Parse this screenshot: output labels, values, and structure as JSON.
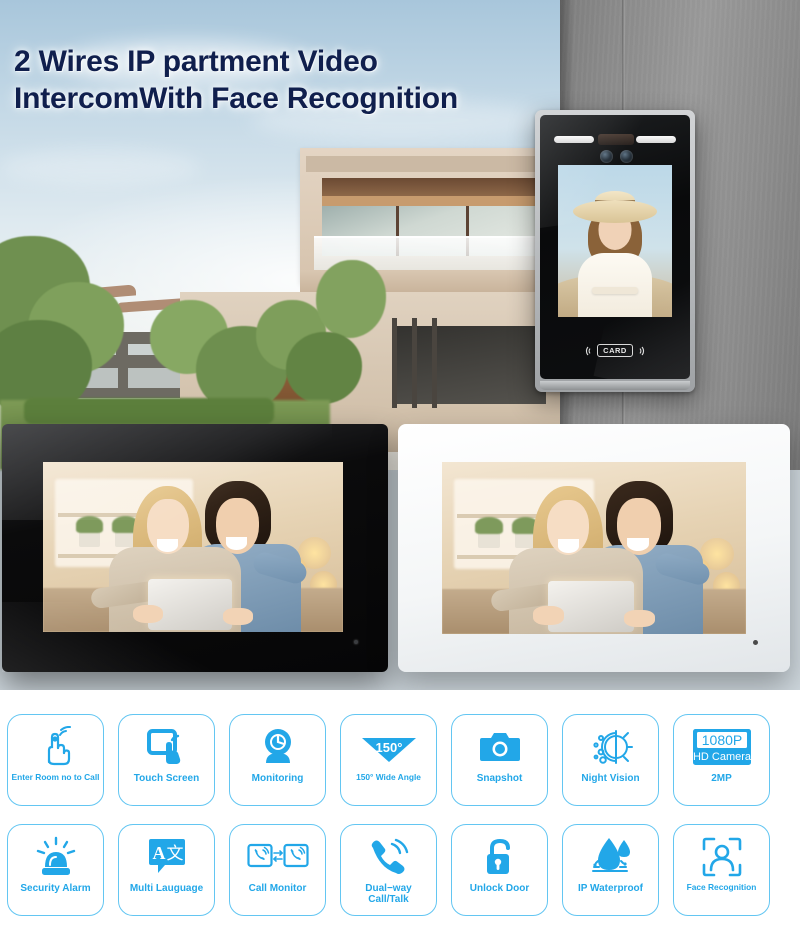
{
  "headline": {
    "line1": "2 Wires IP partment Video",
    "line2": "IntercomWith Face Recognition",
    "color": "#101f4d"
  },
  "colors": {
    "accent": "#22a7e8",
    "tile_border": "#63c6f2",
    "headline": "#101f4d",
    "background": "#ffffff"
  },
  "door_station": {
    "name": "face-recognition-door-station",
    "card_label": "CARD",
    "body_color": "#0b0c0d",
    "trim_color": "#b9bcbf"
  },
  "monitors": [
    {
      "name": "indoor-monitor-black",
      "finish": "Black"
    },
    {
      "name": "indoor-monitor-white",
      "finish": "White"
    }
  ],
  "features": {
    "row1": [
      {
        "label": "Enter Room no to Call",
        "icon": "hand-tap-call-icon",
        "small": true
      },
      {
        "label": "Touch Screen",
        "icon": "touch-screen-icon"
      },
      {
        "label": "Monitoring",
        "icon": "camera-monitor-icon"
      },
      {
        "label": "150° Wide Angle",
        "icon": "wide-angle-icon",
        "badge": "150°",
        "small": true
      },
      {
        "label": "Snapshot",
        "icon": "camera-snapshot-icon"
      },
      {
        "label": "Night Vision",
        "icon": "night-vision-icon"
      },
      {
        "label": "2MP",
        "icon": "hd-camera-badge-icon",
        "badge_top": "1080P",
        "badge_bottom": "HD Camera"
      }
    ],
    "row2": [
      {
        "label": "Security Alarm",
        "icon": "alarm-siren-icon"
      },
      {
        "label": "Multi Lauguage",
        "icon": "multi-language-icon",
        "badge_a": "A",
        "badge_b": "文"
      },
      {
        "label": "Call Monitor",
        "icon": "call-monitor-icon"
      },
      {
        "label": "Dual−way\nCall/Talk",
        "icon": "dual-way-call-icon",
        "two_line": true
      },
      {
        "label": "Unlock Door",
        "icon": "unlock-door-icon"
      },
      {
        "label": "IP Waterproof",
        "icon": "waterproof-droplet-icon"
      },
      {
        "label": "Face Recognition",
        "icon": "face-recognition-icon",
        "small": true
      }
    ]
  }
}
